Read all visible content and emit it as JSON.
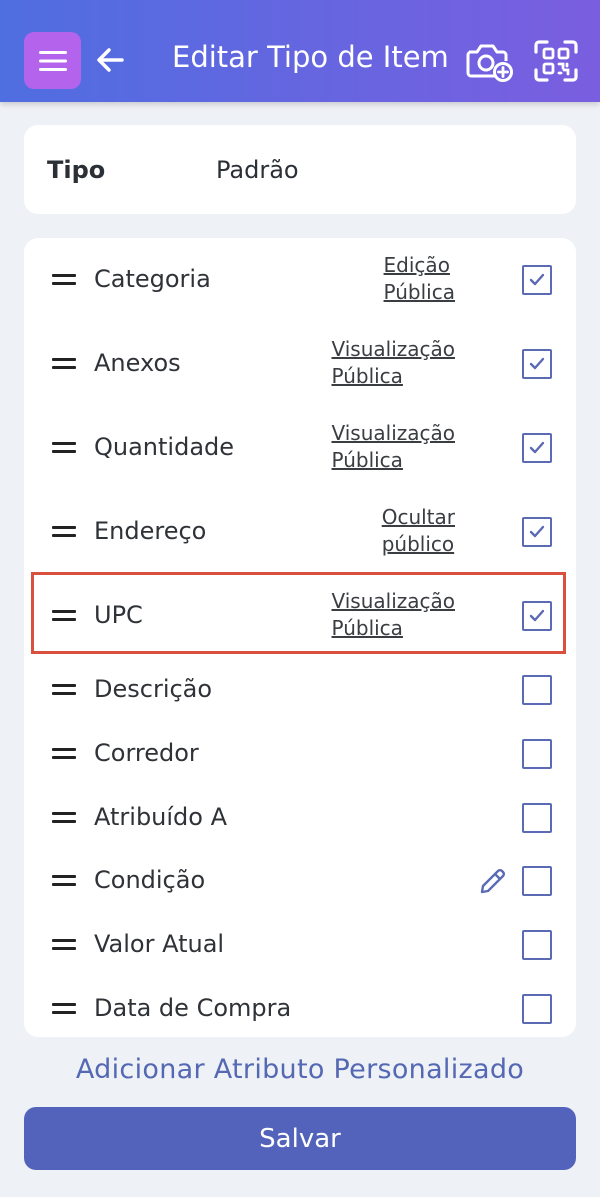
{
  "header": {
    "title": "Editar Tipo de Item",
    "menu_icon": "hamburger-icon",
    "back_icon": "arrow-left-icon",
    "camera_icon": "camera-add-icon",
    "scan_icon": "scan-icon"
  },
  "type": {
    "label": "Tipo",
    "value": "Padrão"
  },
  "attributes": [
    {
      "label": "Categoria",
      "visibility": [
        "Edição",
        "Pública"
      ],
      "checked": true
    },
    {
      "label": "Anexos",
      "visibility": [
        "Visualização",
        "Pública"
      ],
      "checked": true
    },
    {
      "label": "Quantidade",
      "visibility": [
        "Visualização",
        "Pública"
      ],
      "checked": true
    },
    {
      "label": "Endereço",
      "visibility": [
        "Ocultar",
        "público"
      ],
      "checked": true
    },
    {
      "label": "UPC",
      "visibility": [
        "Visualização",
        "Pública"
      ],
      "checked": true,
      "highlighted": true
    },
    {
      "label": "Descrição",
      "checked": false
    },
    {
      "label": "Corredor",
      "checked": false
    },
    {
      "label": "Atribuído A",
      "checked": false
    },
    {
      "label": "Condição",
      "checked": false,
      "editable": true
    },
    {
      "label": "Valor Atual",
      "checked": false
    },
    {
      "label": "Data de Compra",
      "checked": false
    }
  ],
  "add_custom_label": "Adicionar Atributo Personalizado",
  "save_label": "Salvar",
  "colors": {
    "accent": "#5363bb",
    "header_start": "#4f6ee0",
    "header_end": "#7a5ee0",
    "menu_button": "#b463ec",
    "highlight": "#d9503f"
  }
}
